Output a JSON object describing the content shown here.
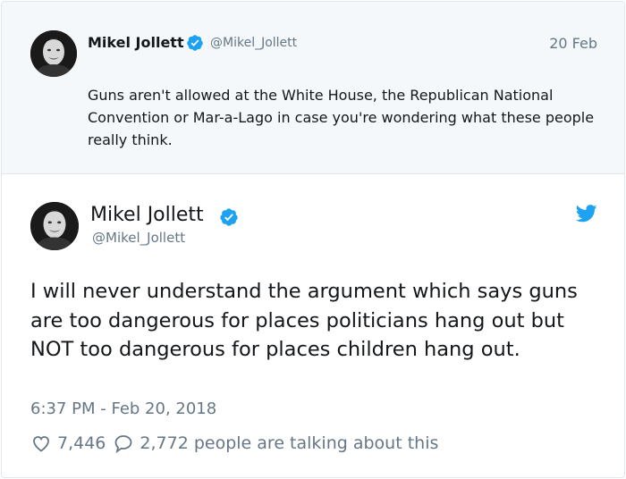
{
  "parent_tweet": {
    "author_name": "Mikel Jollett",
    "author_handle": "@Mikel_Jollett",
    "date": "20 Feb",
    "text": "Guns aren't allowed at the White House, the Republican National Convention or Mar-a-Lago in case you're wondering what these people really think."
  },
  "main_tweet": {
    "author_name": "Mikel Jollett",
    "author_handle": "@Mikel_Jollett",
    "text": "I will never understand the argument which says guns are too dangerous for places politicians hang out but NOT too dangerous for places children hang out.",
    "timestamp": "6:37 PM - Feb 20, 2018",
    "likes": "7,446",
    "replies_text": "2,772 people are talking about this"
  },
  "icons": {
    "verified": "verified-badge-icon",
    "twitter": "twitter-bird-icon",
    "like": "heart-icon",
    "reply": "speech-bubble-icon"
  },
  "colors": {
    "accent": "#1da1f2",
    "secondary_text": "#657786",
    "quoted_background": "#f5f8fa"
  }
}
